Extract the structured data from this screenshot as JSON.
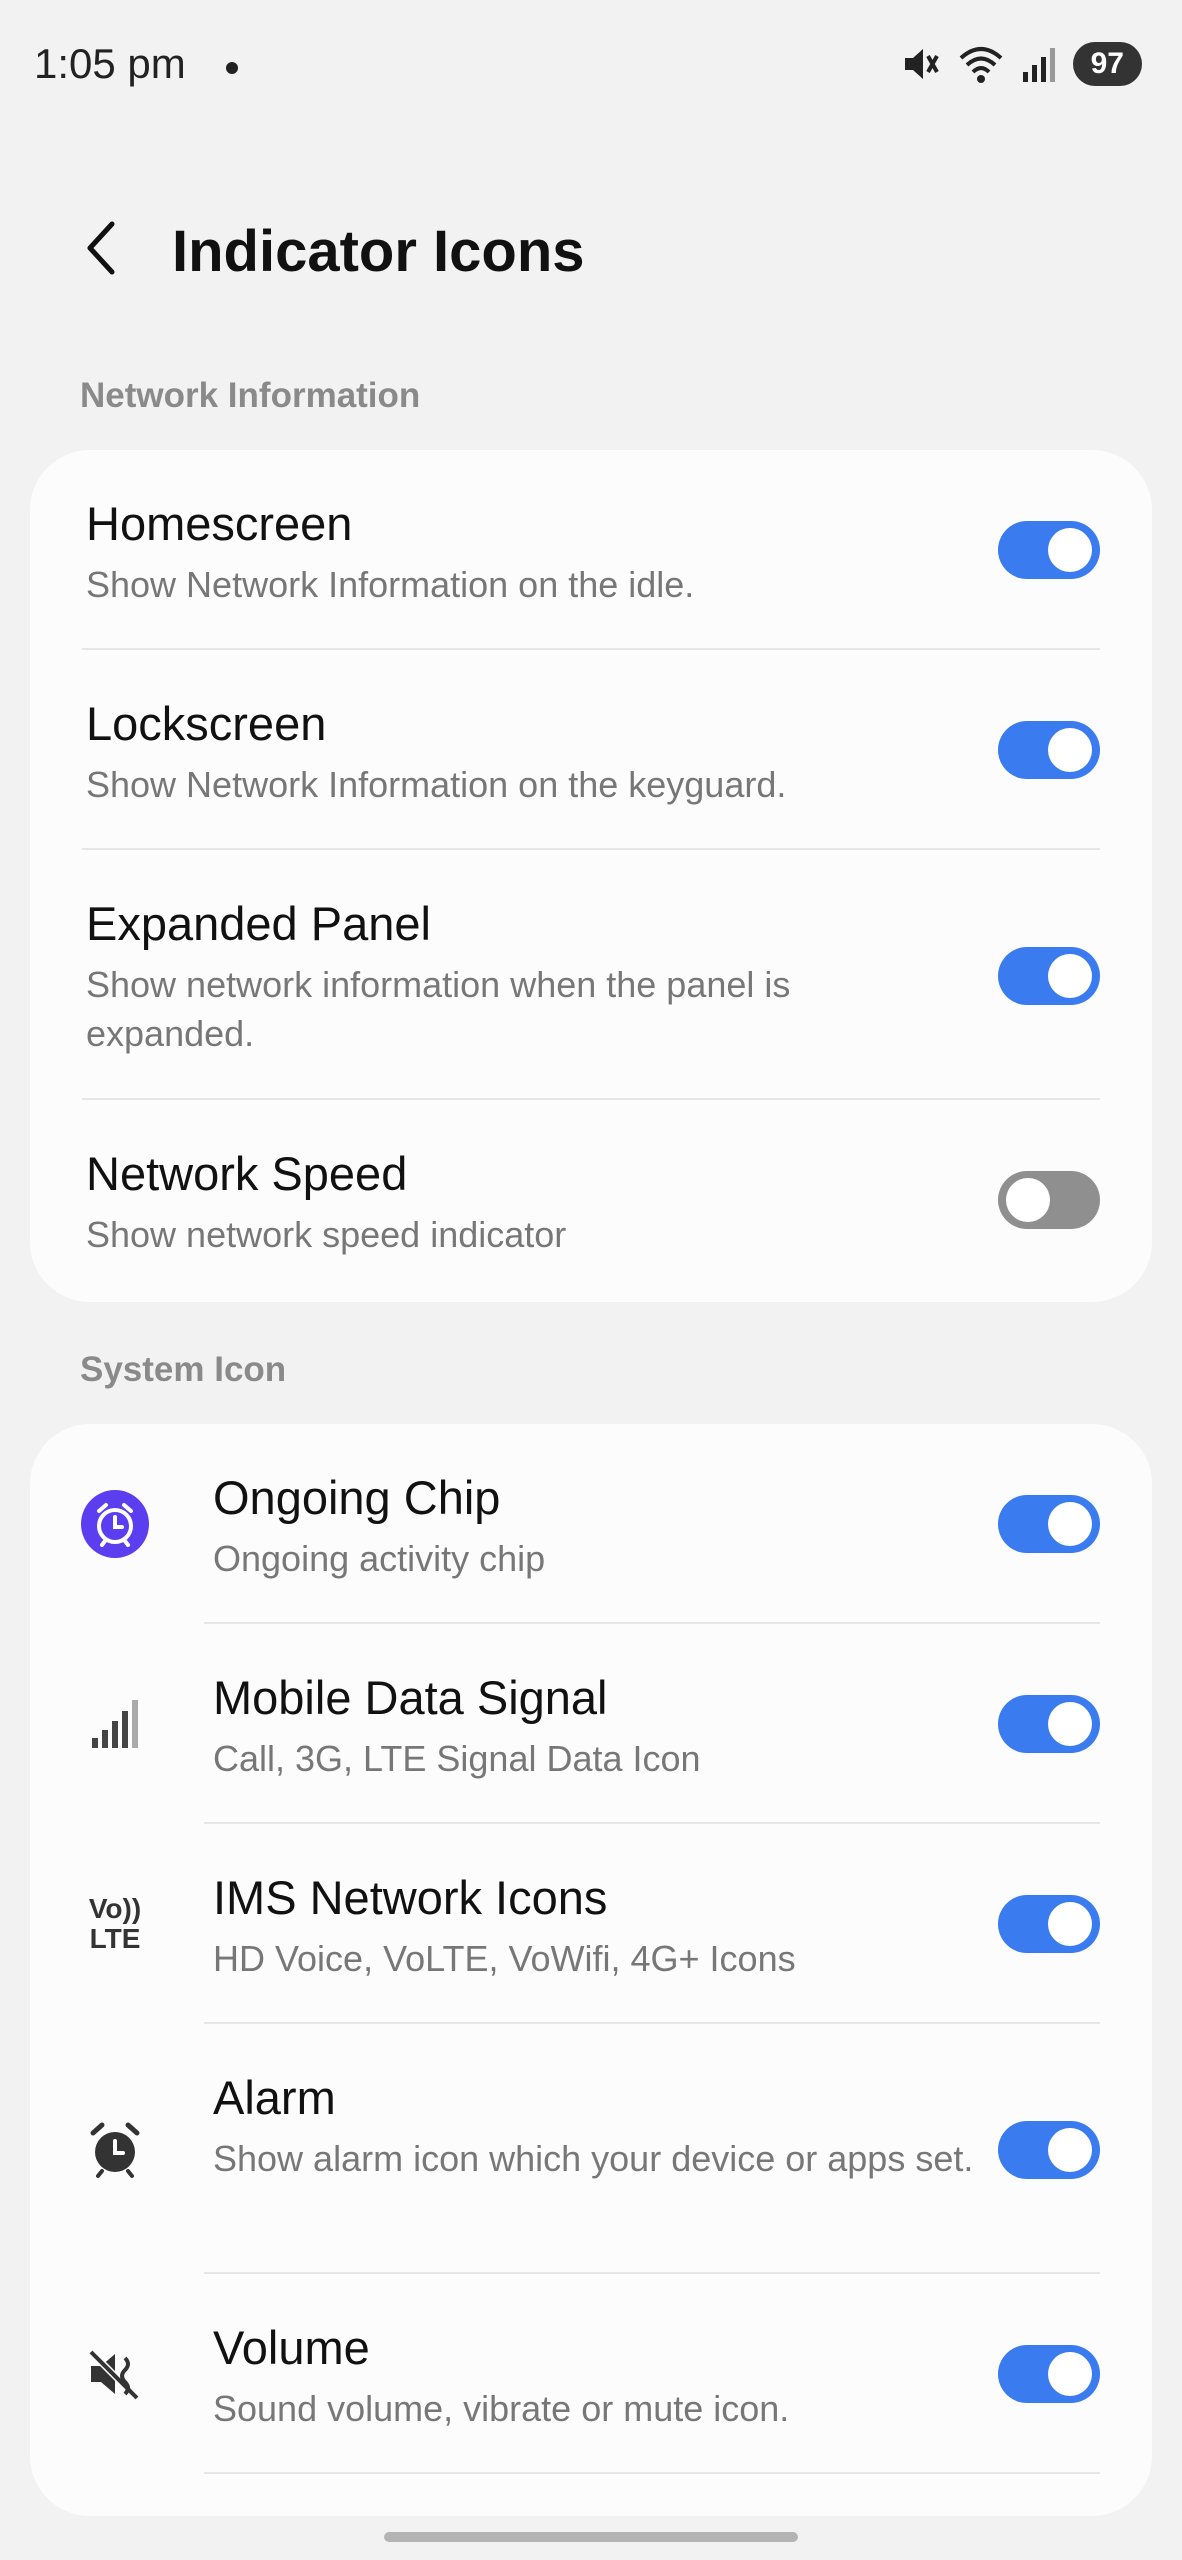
{
  "status_bar": {
    "time": "1:05 pm",
    "battery": "97",
    "icons": [
      "mute-icon",
      "wifi-icon",
      "signal-icon"
    ]
  },
  "header": {
    "title": "Indicator Icons",
    "back_icon": "chevron-left-icon"
  },
  "network_section": {
    "label": "Network Information",
    "items": [
      {
        "title": "Homescreen",
        "subtitle": "Show Network Information on the idle.",
        "enabled": true
      },
      {
        "title": "Lockscreen",
        "subtitle": "Show Network Information on the keyguard.",
        "enabled": true
      },
      {
        "title": "Expanded Panel",
        "subtitle": "Show network information when the panel is expanded.",
        "enabled": true
      },
      {
        "title": "Network Speed",
        "subtitle": "Show network speed indicator",
        "enabled": false
      }
    ]
  },
  "system_section": {
    "label": "System Icon",
    "items": [
      {
        "title": "Ongoing Chip",
        "subtitle": "Ongoing activity chip",
        "icon": "alarm-clock-badge-icon",
        "enabled": true
      },
      {
        "title": "Mobile Data Signal",
        "subtitle": "Call, 3G, LTE Signal Data Icon",
        "icon": "signal-bars-icon",
        "enabled": true
      },
      {
        "title": "IMS Network Icons",
        "subtitle": "HD Voice, VoLTE, VoWifi, 4G+ Icons",
        "icon": "volte-icon",
        "icon_text_top": "Vo",
        "icon_text_bottom": "LTE",
        "enabled": true
      },
      {
        "title": "Alarm",
        "subtitle": "Show alarm icon which your device or apps set.",
        "icon": "alarm-clock-icon",
        "enabled": true
      },
      {
        "title": "Volume",
        "subtitle": "Sound volume, vibrate or mute icon.",
        "icon": "mute-icon",
        "enabled": true
      }
    ]
  },
  "colors": {
    "accent": "#3a7bf0",
    "toggle_off": "#8f8f8f",
    "chip_badge": "#5b3ef0",
    "background": "#f2f2f2",
    "card": "#fcfcfc"
  }
}
